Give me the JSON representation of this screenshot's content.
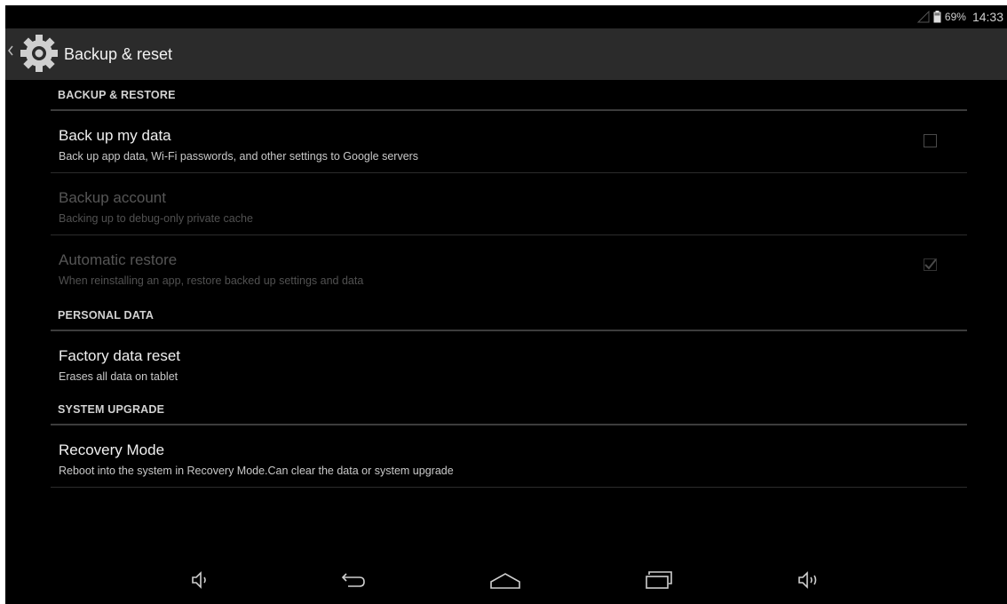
{
  "status_bar": {
    "battery_percent": "69%",
    "time": "14:33",
    "icons": [
      "signal-icon",
      "battery-icon"
    ]
  },
  "action_bar": {
    "title": "Backup & reset",
    "icons": [
      "up-chevron-icon",
      "settings-gear-icon"
    ]
  },
  "sections": {
    "backup_restore": "BACKUP & RESTORE",
    "personal_data": "PERSONAL DATA",
    "system_upgrade": "SYSTEM UPGRADE"
  },
  "prefs": {
    "backup_data": {
      "title": "Back up my data",
      "summary": "Back up app data, Wi-Fi passwords, and other settings to Google servers",
      "checked": false,
      "enabled": true
    },
    "backup_account": {
      "title": "Backup account",
      "summary": "Backing up to debug-only private cache",
      "enabled": false
    },
    "auto_restore": {
      "title": "Automatic restore",
      "summary": "When reinstalling an app, restore backed up settings and data",
      "checked": true,
      "enabled": false
    },
    "factory_reset": {
      "title": "Factory data reset",
      "summary": "Erases all data on tablet",
      "enabled": true
    },
    "recovery_mode": {
      "title": "Recovery Mode",
      "summary": "Reboot into the system in Recovery Mode.Can clear the data or system upgrade",
      "enabled": true
    }
  },
  "nav_bar": {
    "buttons": [
      "volume-down-icon",
      "back-icon",
      "home-icon",
      "recents-icon",
      "volume-up-icon"
    ]
  },
  "colors": {
    "background": "#000000",
    "action_bar": "#2b2b2b",
    "divider": "#3c3c3c",
    "text_primary": "#f0f0f0",
    "text_disabled": "#565656"
  }
}
